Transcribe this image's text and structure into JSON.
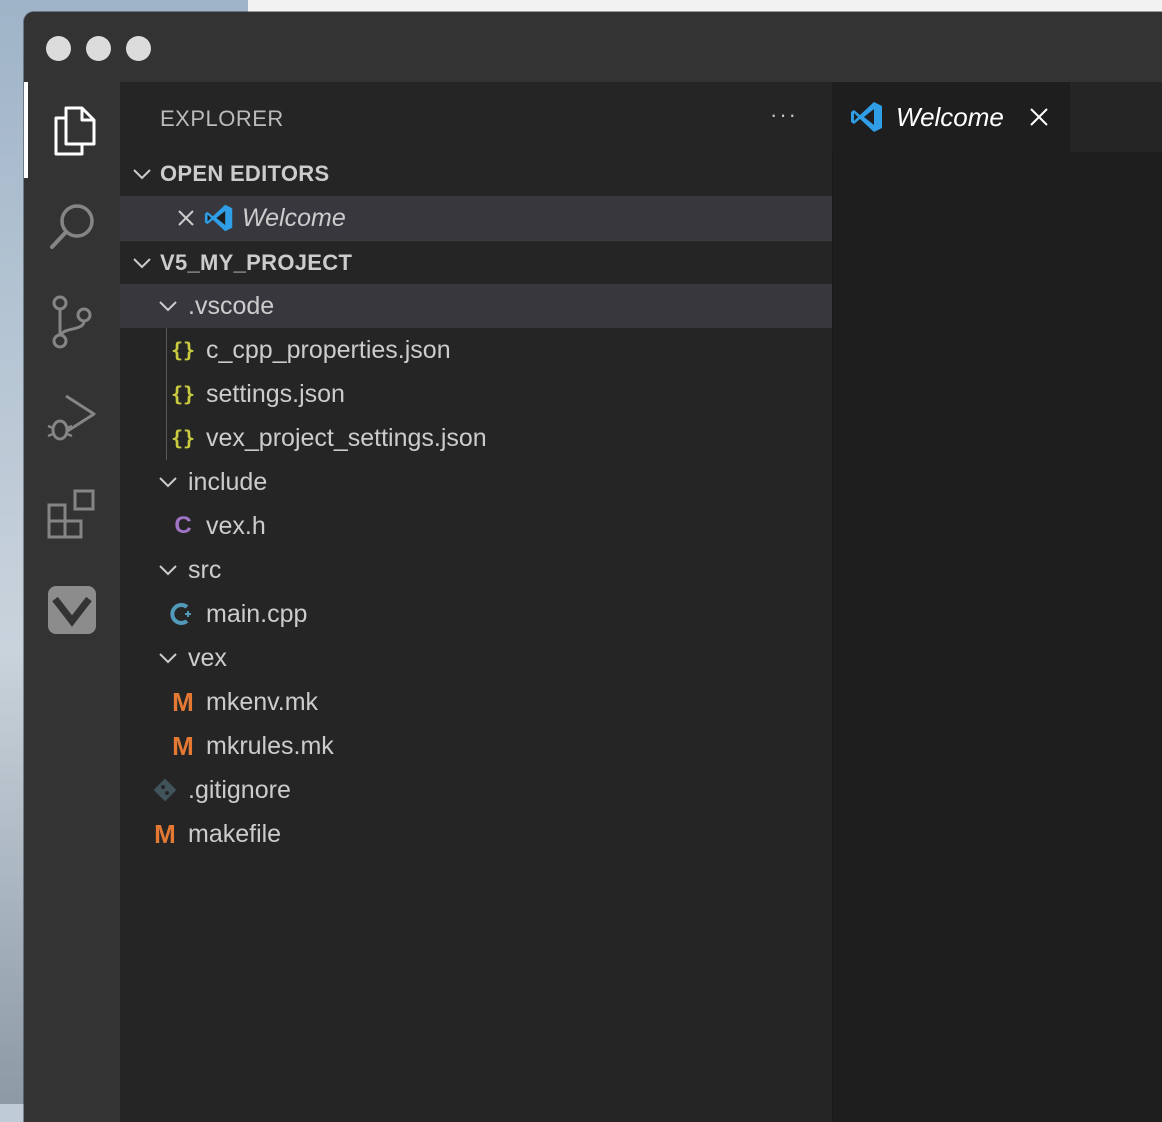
{
  "window": {
    "traffic_lights": [
      "close",
      "minimize",
      "zoom"
    ]
  },
  "activity_bar": {
    "items": [
      {
        "id": "explorer",
        "icon": "files-icon",
        "active": true
      },
      {
        "id": "search",
        "icon": "search-icon"
      },
      {
        "id": "source-control",
        "icon": "source-control-icon"
      },
      {
        "id": "run-debug",
        "icon": "run-debug-icon"
      },
      {
        "id": "extensions",
        "icon": "extensions-icon"
      },
      {
        "id": "vex",
        "icon": "vex-logo-icon"
      }
    ]
  },
  "sidebar": {
    "title": "EXPLORER",
    "more_label": "···",
    "open_editors": {
      "label": "OPEN EDITORS",
      "items": [
        {
          "label": "Welcome",
          "icon": "vscode-logo-icon"
        }
      ]
    },
    "project": {
      "label": "V5_MY_PROJECT",
      "tree": [
        {
          "label": ".vscode",
          "type": "folder"
        },
        {
          "label": "c_cpp_properties.json",
          "type": "json"
        },
        {
          "label": "settings.json",
          "type": "json"
        },
        {
          "label": "vex_project_settings.json",
          "type": "json"
        },
        {
          "label": "include",
          "type": "folder"
        },
        {
          "label": "vex.h",
          "type": "c"
        },
        {
          "label": "src",
          "type": "folder"
        },
        {
          "label": "main.cpp",
          "type": "cpp"
        },
        {
          "label": "vex",
          "type": "folder"
        },
        {
          "label": "mkenv.mk",
          "type": "makefile"
        },
        {
          "label": "mkrules.mk",
          "type": "makefile"
        },
        {
          "label": ".gitignore",
          "type": "git"
        },
        {
          "label": "makefile",
          "type": "makefile"
        }
      ]
    },
    "icons": {
      "json_glyph": "{}",
      "c_glyph": "C",
      "makefile_glyph": "M"
    }
  },
  "editor": {
    "tabs": [
      {
        "label": "Welcome",
        "icon": "vscode-logo-icon",
        "active": true
      }
    ]
  },
  "colors": {
    "json": "#cbcb41",
    "c": "#a074c4",
    "cpp": "#519aba",
    "makefile": "#e37933",
    "git": "#41535b",
    "vscode_blue": "#2f9ee6"
  }
}
